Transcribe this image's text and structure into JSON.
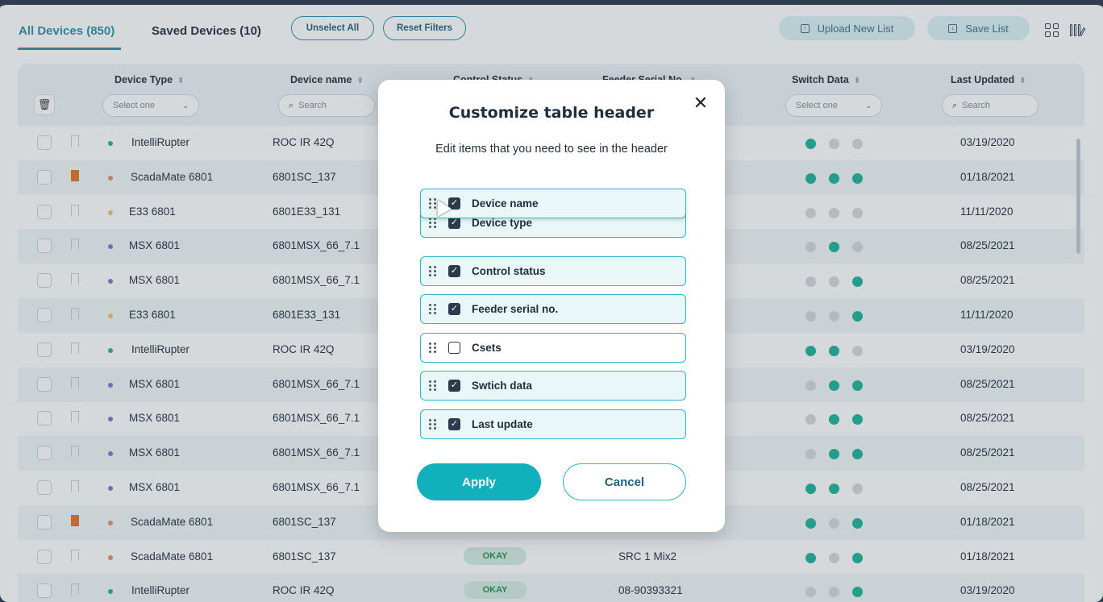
{
  "tabs": [
    {
      "label": "All Devices (850)",
      "active": true
    },
    {
      "label": "Saved Devices (10)",
      "active": false
    }
  ],
  "actions": {
    "unselect_all": "Unselect All",
    "reset_filters": "Reset Filters",
    "upload_list": "Upload New List",
    "save_list": "Save List"
  },
  "table": {
    "headers": {
      "device_type": "Device Type",
      "device_name": "Device name",
      "control_status": "Control Status",
      "feeder_serial": "Feeder Serial No.",
      "switch_data": "Switch Data",
      "last_updated": "Last Updated"
    },
    "filters": {
      "device_type_placeholder": "Select one",
      "device_name_placeholder": "Search",
      "switch_data_placeholder": "Select one",
      "last_updated_placeholder": "Search"
    },
    "colors": {
      "green": "#1cb39a",
      "grey": "#d3d9de",
      "orange": "#e9896a",
      "yellow": "#f0c36a",
      "purple": "#8a6fd6",
      "bookmark": "#e0722c"
    },
    "rows": [
      {
        "type": "IntelliRupter",
        "type_color": "green",
        "name": "ROC IR 42Q",
        "status": "",
        "feeder": "",
        "switch": [
          "green",
          "grey",
          "grey"
        ],
        "updated": "03/19/2020",
        "bookmarked": false
      },
      {
        "type": "ScadaMate 6801",
        "type_color": "orange",
        "name": "6801SC_137",
        "status": "",
        "feeder": "",
        "switch": [
          "green",
          "green",
          "green"
        ],
        "updated": "01/18/2021",
        "bookmarked": true
      },
      {
        "type": "E33 6801",
        "type_color": "yellow",
        "name": "6801E33_131",
        "status": "",
        "feeder": "",
        "switch": [
          "grey",
          "grey",
          "grey"
        ],
        "updated": "11/11/2020",
        "bookmarked": false
      },
      {
        "type": "MSX 6801",
        "type_color": "purple",
        "name": "6801MSX_66_7.1",
        "status": "",
        "feeder": "",
        "switch": [
          "grey",
          "green",
          "grey"
        ],
        "updated": "08/25/2021",
        "bookmarked": false
      },
      {
        "type": "MSX 6801",
        "type_color": "purple",
        "name": "6801MSX_66_7.1",
        "status": "",
        "feeder": "",
        "switch": [
          "grey",
          "grey",
          "green"
        ],
        "updated": "08/25/2021",
        "bookmarked": false
      },
      {
        "type": "E33 6801",
        "type_color": "yellow",
        "name": "6801E33_131",
        "status": "",
        "feeder": "",
        "switch": [
          "grey",
          "grey",
          "green"
        ],
        "updated": "11/11/2020",
        "bookmarked": false
      },
      {
        "type": "IntelliRupter",
        "type_color": "green",
        "name": "ROC IR 42Q",
        "status": "",
        "feeder": "",
        "switch": [
          "green",
          "green",
          "grey"
        ],
        "updated": "03/19/2020",
        "bookmarked": false
      },
      {
        "type": "MSX 6801",
        "type_color": "purple",
        "name": "6801MSX_66_7.1",
        "status": "",
        "feeder": "",
        "switch": [
          "grey",
          "green",
          "green"
        ],
        "updated": "08/25/2021",
        "bookmarked": false
      },
      {
        "type": "MSX 6801",
        "type_color": "purple",
        "name": "6801MSX_66_7.1",
        "status": "",
        "feeder": "",
        "switch": [
          "grey",
          "green",
          "green"
        ],
        "updated": "08/25/2021",
        "bookmarked": false
      },
      {
        "type": "MSX 6801",
        "type_color": "purple",
        "name": "6801MSX_66_7.1",
        "status": "",
        "feeder": "",
        "switch": [
          "grey",
          "green",
          "green"
        ],
        "updated": "08/25/2021",
        "bookmarked": false
      },
      {
        "type": "MSX 6801",
        "type_color": "purple",
        "name": "6801MSX_66_7.1",
        "status": "",
        "feeder": "",
        "switch": [
          "green",
          "green",
          "grey"
        ],
        "updated": "08/25/2021",
        "bookmarked": false
      },
      {
        "type": "ScadaMate 6801",
        "type_color": "orange",
        "name": "6801SC_137",
        "status": "",
        "feeder": "",
        "switch": [
          "green",
          "grey",
          "green"
        ],
        "updated": "01/18/2021",
        "bookmarked": true
      },
      {
        "type": "ScadaMate 6801",
        "type_color": "orange",
        "name": "6801SC_137",
        "status": "OKAY",
        "feeder": "SRC 1 Mix2",
        "switch": [
          "green",
          "grey",
          "green"
        ],
        "updated": "01/18/2021",
        "bookmarked": false
      },
      {
        "type": "IntelliRupter",
        "type_color": "green",
        "name": "ROC IR 42Q",
        "status": "OKAY",
        "feeder": "08-90393321",
        "switch": [
          "grey",
          "grey",
          "green"
        ],
        "updated": "03/19/2020",
        "bookmarked": false
      }
    ]
  },
  "modal": {
    "title": "Customize table header",
    "subtitle": "Edit items that you need to see in the header",
    "close_icon": "close-icon",
    "items": [
      {
        "label": "Device name",
        "checked": true,
        "dragging": true
      },
      {
        "label": "Device type",
        "checked": true
      },
      {
        "label": "Control status",
        "checked": true
      },
      {
        "label": "Feeder serial no.",
        "checked": true
      },
      {
        "label": "Csets",
        "checked": false
      },
      {
        "label": "Swtich data",
        "checked": true
      },
      {
        "label": "Last update",
        "checked": true
      }
    ],
    "apply_label": "Apply",
    "cancel_label": "Cancel"
  }
}
